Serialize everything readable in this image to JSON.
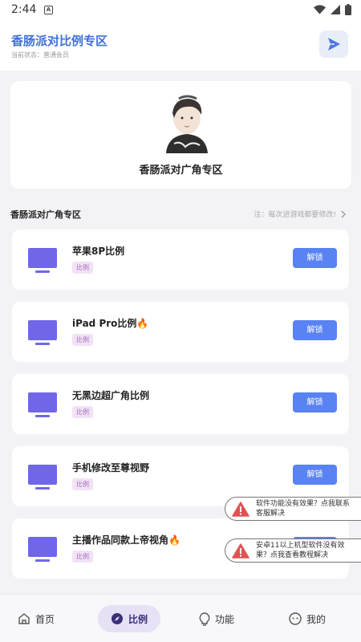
{
  "status_bar": {
    "time": "2:44",
    "notif_icon": "A"
  },
  "header": {
    "title": "香肠派对比例专区",
    "status": "当前状态：普通会员"
  },
  "profile": {
    "name": "香肠派对广角专区"
  },
  "section": {
    "title": "香肠派对广角专区",
    "note": "注：每次进游戏都要修改!"
  },
  "items": [
    {
      "title": "苹果8P比例",
      "tag": "比例",
      "button": "解锁"
    },
    {
      "title": "iPad Pro比例🔥",
      "tag": "比例",
      "button": "解锁"
    },
    {
      "title": "无黑边超广角比例",
      "tag": "比例",
      "button": "解锁"
    },
    {
      "title": "手机修改至尊视野",
      "tag": "比例",
      "button": "解锁"
    },
    {
      "title": "主播作品同款上帝视角🔥",
      "tag": "比例",
      "button": "解锁"
    }
  ],
  "toasts": [
    {
      "text": "软件功能没有效果？点我联系客服解决",
      "icon": "warning-icon"
    },
    {
      "text": "安卓11以上机型软件没有效果？点我查看教程解决",
      "icon": "warning-icon"
    }
  ],
  "nav": {
    "items": [
      {
        "label": "首页",
        "icon": "home-icon"
      },
      {
        "label": "比例",
        "icon": "compass-icon",
        "active": true
      },
      {
        "label": "功能",
        "icon": "bulb-icon"
      },
      {
        "label": "我的",
        "icon": "face-icon"
      }
    ]
  },
  "colors": {
    "accent": "#5983f3",
    "title_blue": "#3f6fd8",
    "monitor": "#6f67e8",
    "tag_bg": "#f1e2f5",
    "warning": "#e05252"
  }
}
